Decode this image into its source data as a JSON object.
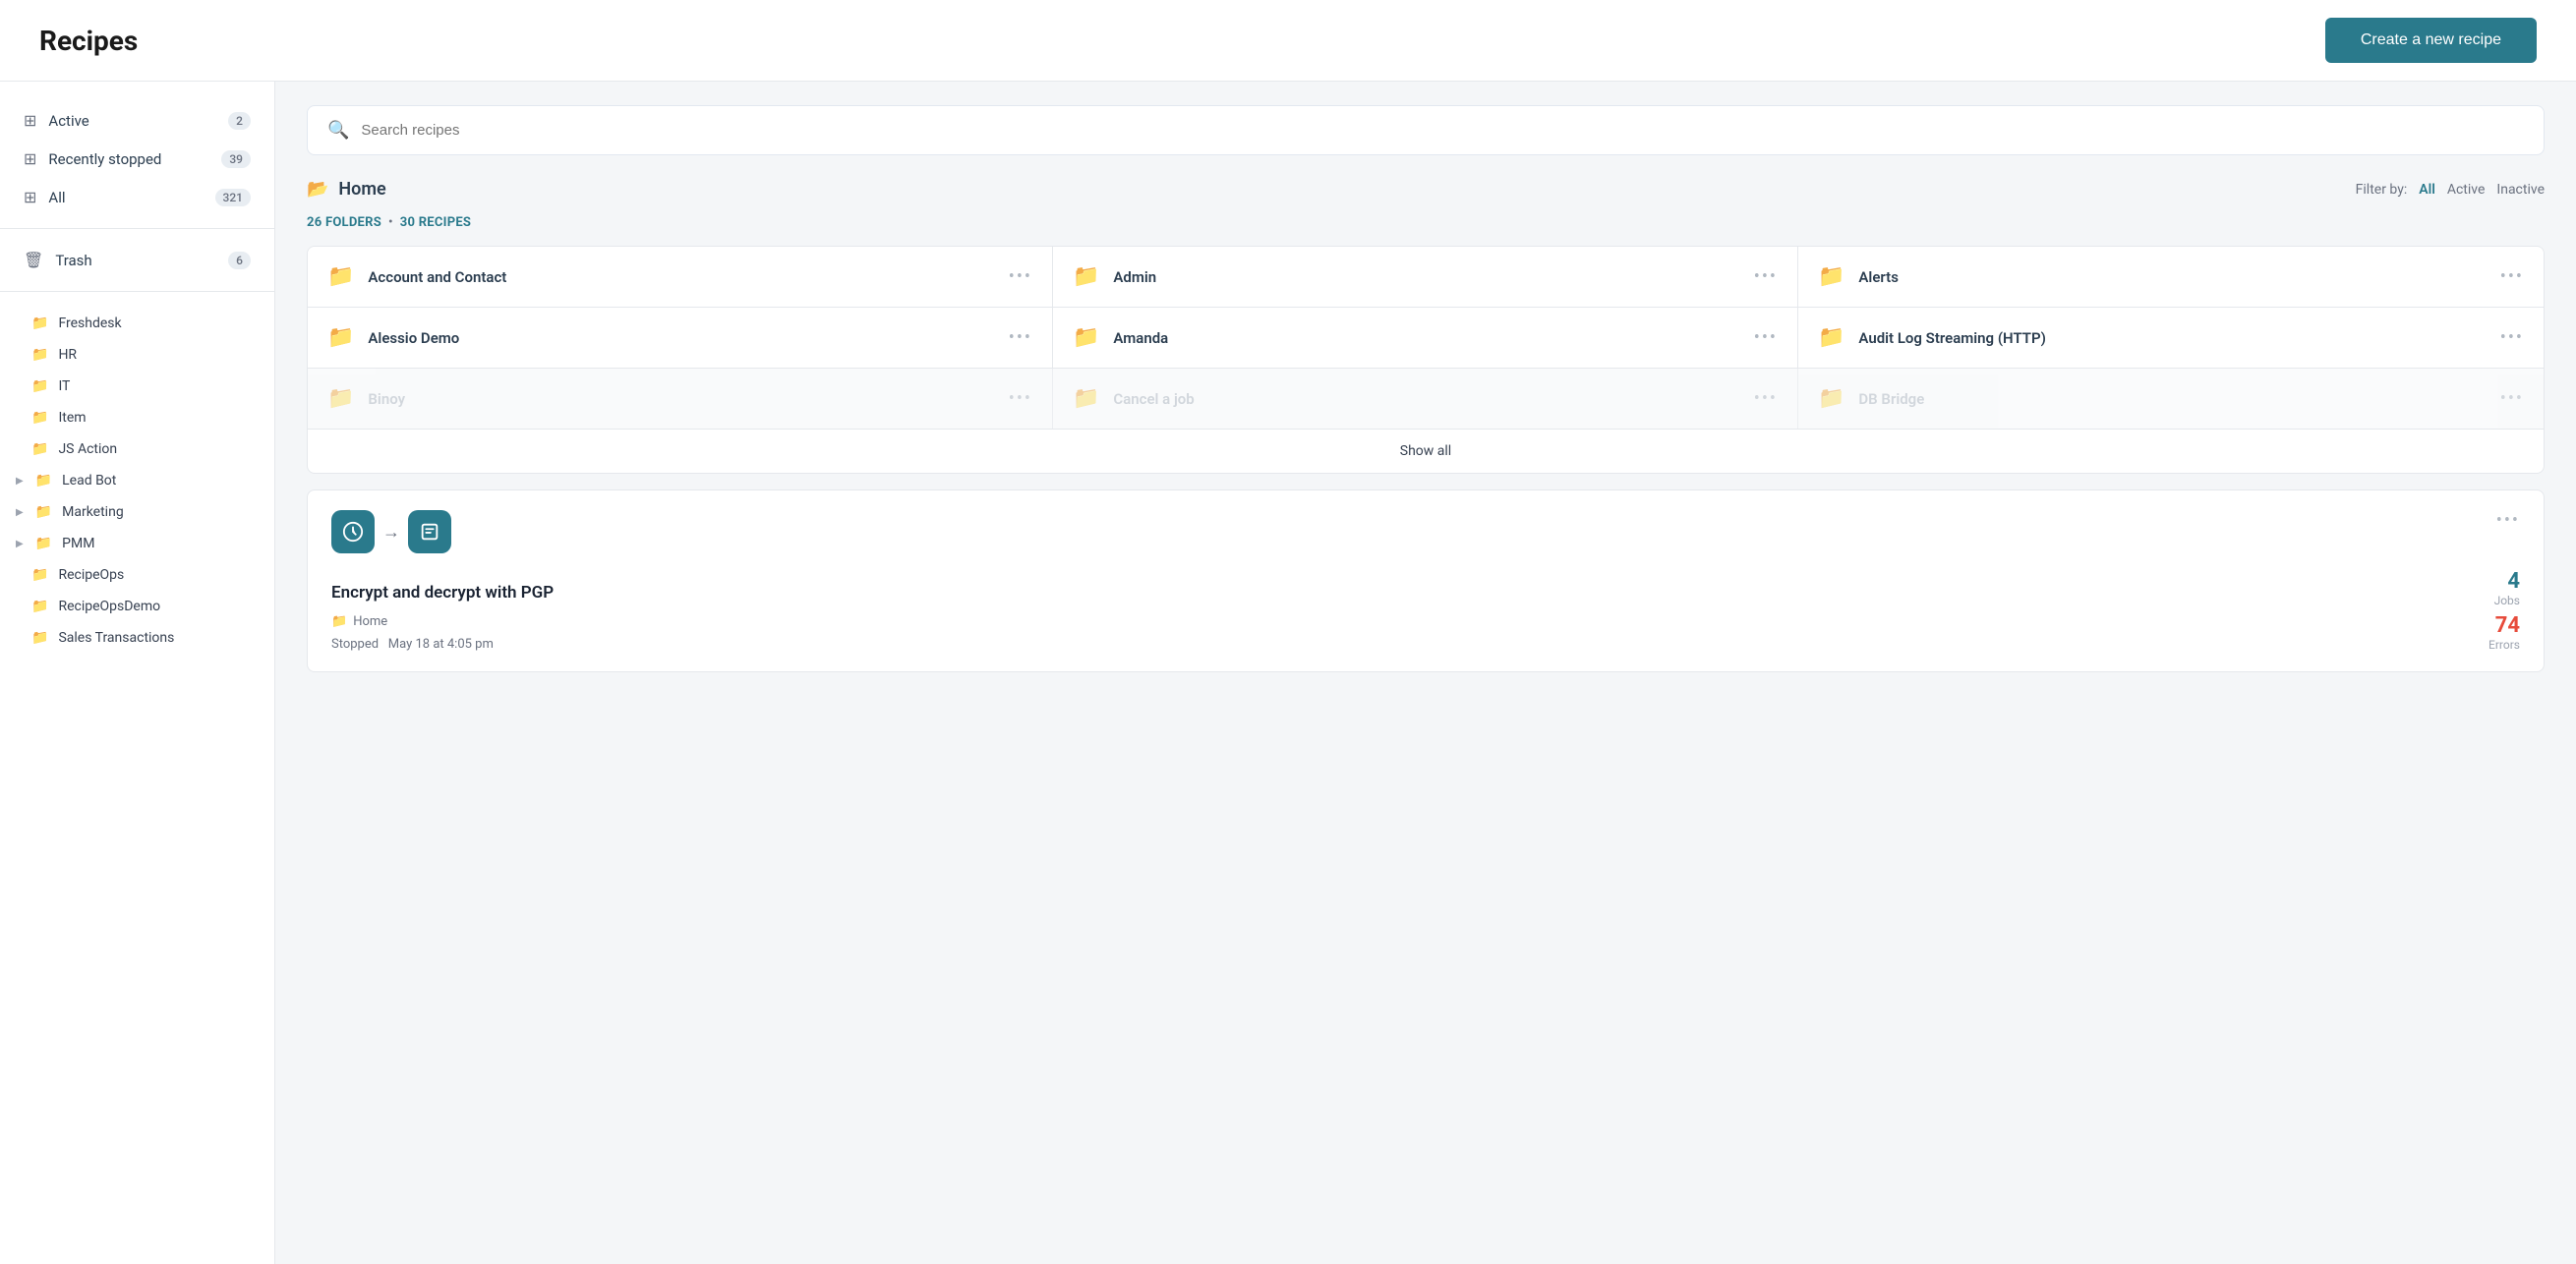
{
  "header": {
    "title": "Recipes",
    "create_button": "Create a new recipe"
  },
  "sidebar": {
    "nav_items": [
      {
        "id": "active",
        "label": "Active",
        "badge": "2",
        "icon": "▦"
      },
      {
        "id": "recently-stopped",
        "label": "Recently stopped",
        "badge": "39",
        "icon": "▦"
      },
      {
        "id": "all",
        "label": "All",
        "badge": "321",
        "icon": "▦"
      }
    ],
    "trash": {
      "label": "Trash",
      "badge": "6",
      "icon": "🗑"
    },
    "folders": [
      {
        "label": "Freshdesk",
        "has_arrow": false
      },
      {
        "label": "HR",
        "has_arrow": false
      },
      {
        "label": "IT",
        "has_arrow": false
      },
      {
        "label": "Item",
        "has_arrow": false
      },
      {
        "label": "JS Action",
        "has_arrow": false
      },
      {
        "label": "Lead Bot",
        "has_arrow": true
      },
      {
        "label": "Marketing",
        "has_arrow": true
      },
      {
        "label": "PMM",
        "has_arrow": true
      },
      {
        "label": "RecipeOps",
        "has_arrow": false
      },
      {
        "label": "RecipeOpsDemo",
        "has_arrow": false
      },
      {
        "label": "Sales Transactions",
        "has_arrow": false
      }
    ]
  },
  "search": {
    "placeholder": "Search recipes"
  },
  "main": {
    "section_title": "Home",
    "filter_label": "Filter by:",
    "filters": [
      "All",
      "Active",
      "Inactive"
    ],
    "active_filter": "All",
    "stats": {
      "folders_count": "26",
      "folders_label": "FOLDERS",
      "recipes_count": "30",
      "recipes_label": "RECIPES"
    },
    "folders": [
      {
        "name": "Account and Contact",
        "faded": false
      },
      {
        "name": "Admin",
        "faded": false
      },
      {
        "name": "Alerts",
        "faded": false
      },
      {
        "name": "Alessio Demo",
        "faded": false
      },
      {
        "name": "Amanda",
        "faded": false
      },
      {
        "name": "Audit Log Streaming (HTTP)",
        "faded": false
      },
      {
        "name": "Binoy",
        "faded": true
      },
      {
        "name": "Cancel a job",
        "faded": true
      },
      {
        "name": "DB Bridge",
        "faded": true
      }
    ],
    "show_all_label": "Show all",
    "recipe_card": {
      "title": "Encrypt and decrypt with PGP",
      "location": "Home",
      "status_label": "Stopped",
      "status_date": "May 18 at 4:05 pm",
      "jobs_count": "4",
      "jobs_label": "Jobs",
      "errors_count": "74",
      "errors_label": "Errors"
    }
  },
  "colors": {
    "teal": "#2a7a8c",
    "red": "#e74c3c"
  }
}
